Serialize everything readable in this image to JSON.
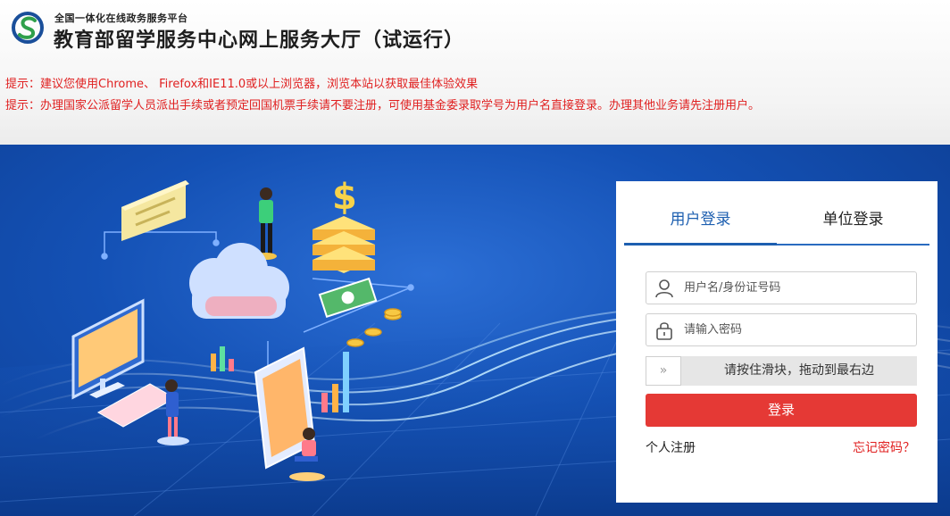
{
  "header": {
    "platform": "全国一体化在线政务服务平台",
    "title": "教育部留学服务中心网上服务大厅（试运行）",
    "tips": [
      "提示：建议您使用Chrome、 Firefox和IE11.0或以上浏览器，浏览本站以获取最佳体验效果",
      "提示：办理国家公派留学人员派出手续或者预定回国机票手续请不要注册，可使用基金委录取学号为用户名直接登录。办理其他业务请先注册用户。"
    ]
  },
  "login": {
    "tabs": [
      "用户登录",
      "单位登录"
    ],
    "active_tab": "用户登录",
    "username_placeholder": "用户名/身份证号码",
    "password_placeholder": "请输入密码",
    "slider_handle": "»",
    "slider_text": "请按住滑块，拖动到最右边",
    "submit": "登录",
    "register": "个人注册",
    "forgot": "忘记密码？"
  },
  "colors": {
    "accent": "#1d5fb0",
    "danger": "#e53935",
    "tip_text": "#e02020"
  },
  "icons": {
    "logo": "site-logo",
    "user": "user-icon",
    "lock": "lock-icon",
    "slider": "double-chevron-right-icon"
  }
}
